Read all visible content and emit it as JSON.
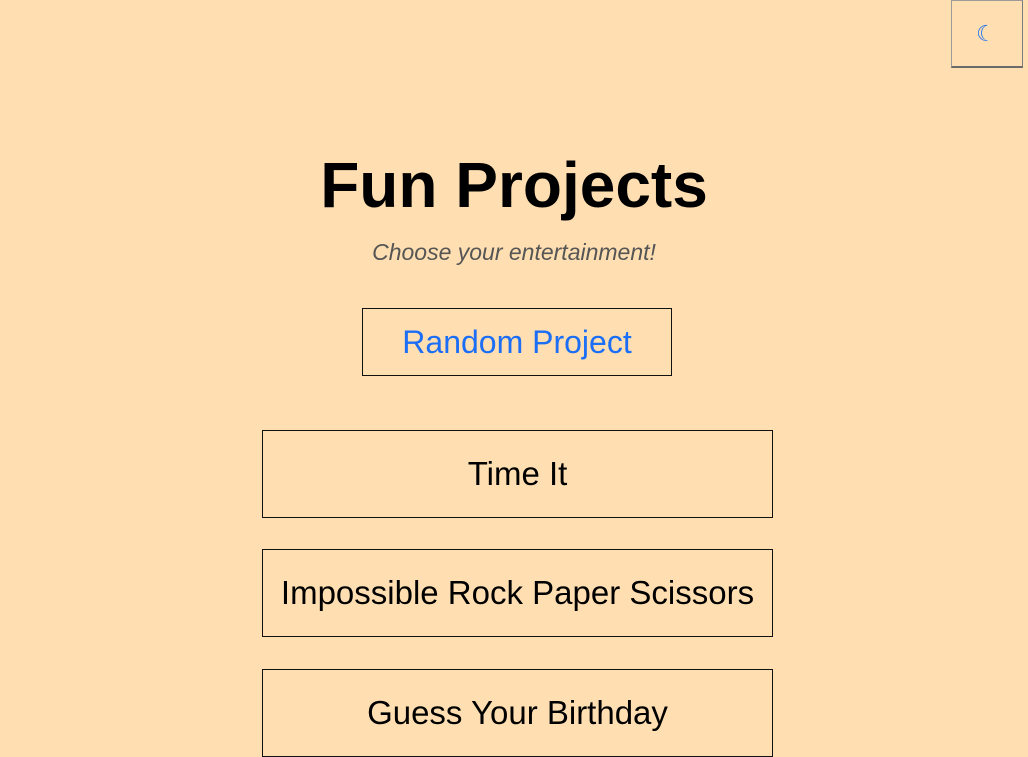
{
  "theme_toggle": {
    "icon": "moon-icon",
    "glyph": "☾",
    "accent_color": "#1b6ef5"
  },
  "header": {
    "title": "Fun Projects",
    "subtitle": "Choose your entertainment!"
  },
  "random_button": {
    "label": "Random Project"
  },
  "projects": [
    {
      "label": "Time It"
    },
    {
      "label": "Impossible Rock Paper Scissors"
    },
    {
      "label": "Guess Your Birthday"
    }
  ],
  "colors": {
    "background": "#ffdfb1",
    "link_blue": "#1b6ef5",
    "subtitle_gray": "#555555"
  }
}
